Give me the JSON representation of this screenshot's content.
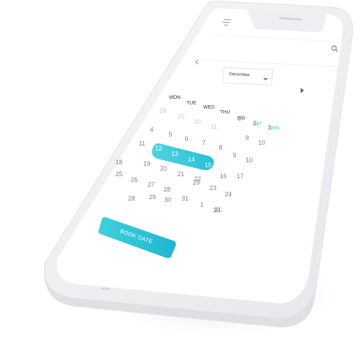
{
  "calendar": {
    "month_select": {
      "value": "December"
    },
    "weekdays": [
      "MON",
      "TUE",
      "WED",
      "THU",
      "FRI",
      "SAT",
      "SUN"
    ],
    "weekend_color": "#33c4dc",
    "accent": "#2ec5d9",
    "weeks": [
      [
        {
          "d": "28",
          "m": true
        },
        {
          "d": "29",
          "m": true
        },
        {
          "d": "30",
          "m": true
        },
        {
          "d": "31",
          "m": true
        },
        {
          "d": "1"
        },
        {
          "d": "2"
        },
        {
          "d": "3"
        }
      ],
      [
        {
          "d": "4"
        },
        {
          "d": "5"
        },
        {
          "d": "6"
        },
        {
          "d": "7"
        },
        {
          "d": "8"
        },
        {
          "d": "9"
        },
        {
          "d": "10"
        }
      ],
      [
        {
          "d": "11"
        },
        {
          "d": "12",
          "s": true
        },
        {
          "d": "13",
          "s": true
        },
        {
          "d": "14",
          "s": true
        },
        {
          "d": "15",
          "s": true
        },
        {
          "d": "9"
        },
        {
          "d": "10"
        }
      ],
      [
        {
          "d": "18"
        },
        {
          "d": "19"
        },
        {
          "d": "20"
        },
        {
          "d": "21"
        },
        {
          "d": "22"
        },
        {
          "d": "16"
        },
        {
          "d": "17"
        }
      ],
      [
        {
          "d": "25"
        },
        {
          "d": "26"
        },
        {
          "d": "27"
        },
        {
          "d": "28"
        },
        {
          "d": "29"
        },
        {
          "d": "23"
        },
        {
          "d": "24"
        }
      ],
      [
        {
          "d": "28"
        },
        {
          "d": "29"
        },
        {
          "d": "30"
        },
        {
          "d": "31"
        },
        {
          "d": "1"
        },
        {
          "d": "30"
        },
        {
          "d": "31"
        }
      ]
    ]
  },
  "book_button": {
    "label": "BOOK DATE"
  },
  "icons": {
    "menu": "menu-icon",
    "search": "search-icon",
    "prev": "chevron-left-icon",
    "next": "chevron-right-icon",
    "dropdown": "chevron-down-icon"
  }
}
